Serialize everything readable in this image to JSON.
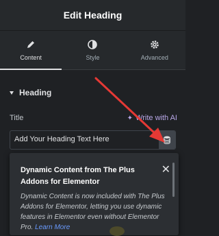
{
  "header": {
    "title": "Edit Heading"
  },
  "tabs": [
    {
      "label": "Content",
      "icon": "pencil-icon",
      "active": true
    },
    {
      "label": "Style",
      "icon": "contrast-icon",
      "active": false
    },
    {
      "label": "Advanced",
      "icon": "gear-icon",
      "active": false
    }
  ],
  "section": {
    "label": "Heading"
  },
  "title_field": {
    "label": "Title",
    "ai_link": "Write with AI",
    "value": "Add Your Heading Text Here"
  },
  "popup": {
    "title": "Dynamic Content from The Plus Addons for Elementor",
    "description": "Dynamic Content is now included with The Plus Addons for Elementor, letting you use dynamic features in Elementor even without Elementor Pro.",
    "link": "Learn More"
  },
  "colors": {
    "panel": "#26292c",
    "background": "#1f2124",
    "annotation_arrow": "#e53935",
    "link": "#6a9bff",
    "ai": "#b9a8e8"
  }
}
